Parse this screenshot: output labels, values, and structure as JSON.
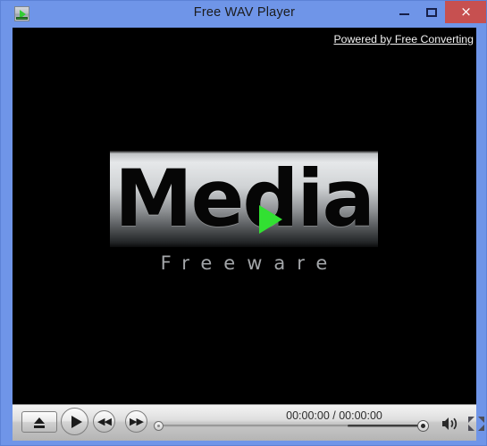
{
  "window": {
    "title": "Free WAV Player",
    "app_icon": "media-player-icon",
    "frame_color": "#6f95e8",
    "controls": {
      "minimize": "minimize-icon",
      "maximize": "maximize-icon",
      "close": "×",
      "close_color": "#c75050"
    }
  },
  "content": {
    "background_color": "#000000",
    "powered_link": "Powered by Free Converting",
    "logo": {
      "primary": "Media",
      "secondary": "Freeware",
      "play_triangle_color": "#32e032"
    }
  },
  "player_controls": {
    "eject_label": "eject-icon",
    "play_label": "play-icon",
    "previous_label": "◀◀",
    "next_label": "▶▶",
    "time_display": "00:00:00 / 00:00:00",
    "elapsed": "00:00:00",
    "duration": "00:00:00",
    "seek_position_percent": 0,
    "volume_percent": 100,
    "mute_label": "volume-icon",
    "fullscreen_label": "fullscreen-icon"
  }
}
